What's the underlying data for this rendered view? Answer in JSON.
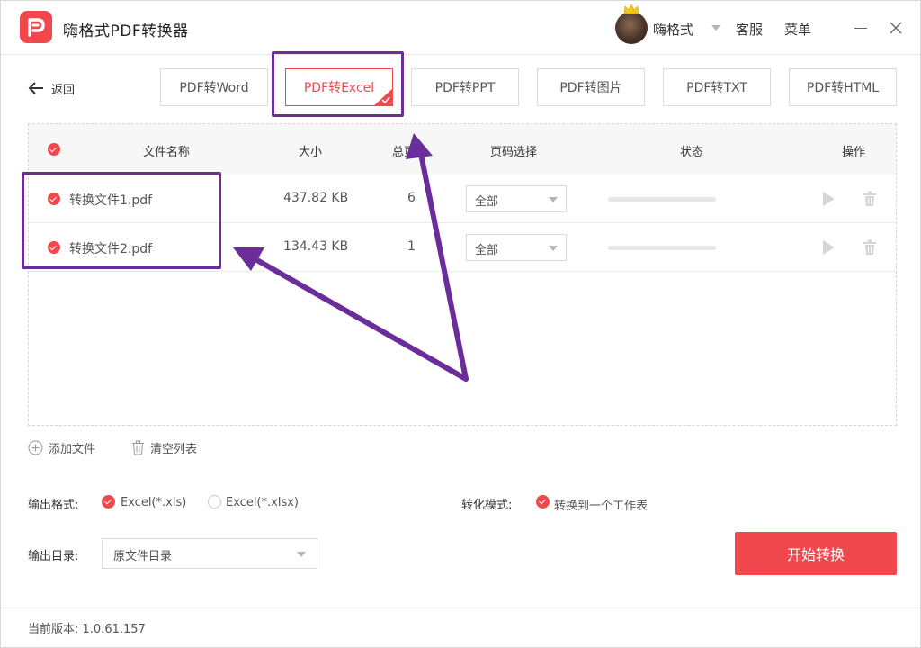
{
  "app": {
    "title": "嗨格式PDF转换器",
    "user_name": "嗨格式",
    "service": "客服",
    "menu": "菜单"
  },
  "nav": {
    "back": "返回",
    "tabs": [
      {
        "label": "PDF转Word"
      },
      {
        "label": "PDF转Excel",
        "active": true
      },
      {
        "label": "PDF转PPT"
      },
      {
        "label": "PDF转图片"
      },
      {
        "label": "PDF转TXT"
      },
      {
        "label": "PDF转HTML"
      }
    ]
  },
  "table": {
    "headers": {
      "name": "文件名称",
      "size": "大小",
      "pages": "总页数",
      "page_select": "页码选择",
      "status": "状态",
      "actions": "操作"
    },
    "rows": [
      {
        "name": "转换文件1.pdf",
        "size": "437.82 KB",
        "pages": "6",
        "page_select": "全部"
      },
      {
        "name": "转换文件2.pdf",
        "size": "134.43 KB",
        "pages": "1",
        "page_select": "全部"
      }
    ]
  },
  "list_actions": {
    "add": "添加文件",
    "clear": "清空列表"
  },
  "options": {
    "format_label": "输出格式:",
    "format_xls": "Excel(*.xls)",
    "format_xlsx": "Excel(*.xlsx)",
    "mode_label": "转化模式:",
    "mode_value": "转换到一个工作表",
    "dir_label": "输出目录:",
    "dir_value": "原文件目录",
    "start": "开始转换"
  },
  "footer": {
    "version": "当前版本: 1.0.61.157"
  },
  "colors": {
    "accent": "#f0484d",
    "annotation": "#6a2d9a"
  }
}
